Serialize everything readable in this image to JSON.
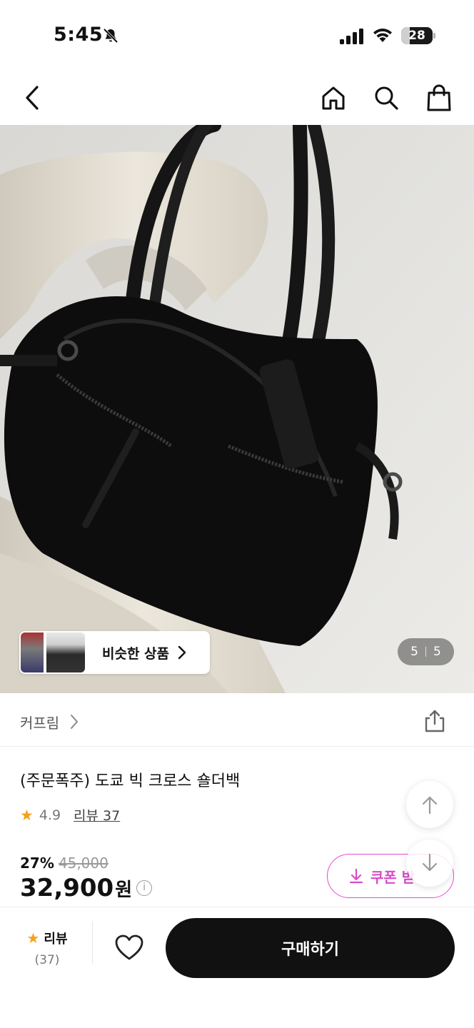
{
  "status_bar": {
    "time": "5:45",
    "battery": "28",
    "battery_level_percent": 28
  },
  "nav": {
    "icons": [
      "back-icon",
      "home-icon",
      "search-icon",
      "shopping-bag-icon"
    ]
  },
  "gallery": {
    "similar_label": "비슷한 상품",
    "current_page": "5",
    "total_pages": "5"
  },
  "brand": {
    "name": "커프림",
    "arrow": "›"
  },
  "product": {
    "title": "(주문폭주) 도쿄 빅 크로스 숄더백",
    "rating": "4.9",
    "review_link": "리뷰 37",
    "discount": "27%",
    "original_price": "45,000",
    "price": "32,900",
    "price_unit": "원",
    "info_symbol": "i"
  },
  "coupon": {
    "label": "쿠폰 받"
  },
  "bottom_bar": {
    "review_label": "리뷰",
    "review_count": "(37)",
    "buy_label": "구매하기"
  },
  "colors": {
    "accent": "#d94bc9",
    "star": "#f4a11b",
    "primary": "#111111"
  }
}
